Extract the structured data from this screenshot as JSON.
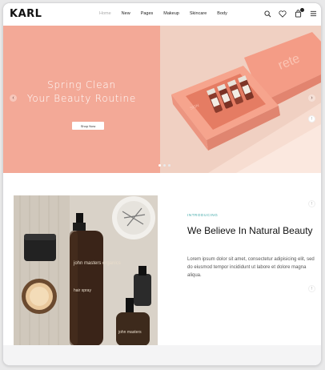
{
  "brand": {
    "logo": "KARL"
  },
  "nav": {
    "items": [
      "Home",
      "New",
      "Pages",
      "Makeup",
      "Skincare",
      "Body"
    ],
    "active": "Home"
  },
  "header_icons": [
    "search-icon",
    "heart-icon",
    "cart-icon",
    "menu-icon"
  ],
  "hero": {
    "title_line1": "Spring Clean",
    "title_line2": "Your Beauty Routine",
    "button_label": "Shop Now",
    "box_label": "rete",
    "slide_count": 3,
    "active_slide": 1,
    "colors": {
      "left_bg": "#f3a997",
      "right_bg": "#f0d0c2",
      "box": "#f29a84"
    }
  },
  "about": {
    "eyebrow": "INTRODUCING",
    "title": "We Believe In Natural Beauty",
    "text": "Lorem ipsum dolor sit amet, consectetur adipisicing elit, sed do eiusmod tempor incididunt ut labore et dolore magna aliqua.",
    "bottle_label_1": "john masters organics",
    "bottle_label_2": "hair spray",
    "bottle_label_3": "john masters"
  }
}
